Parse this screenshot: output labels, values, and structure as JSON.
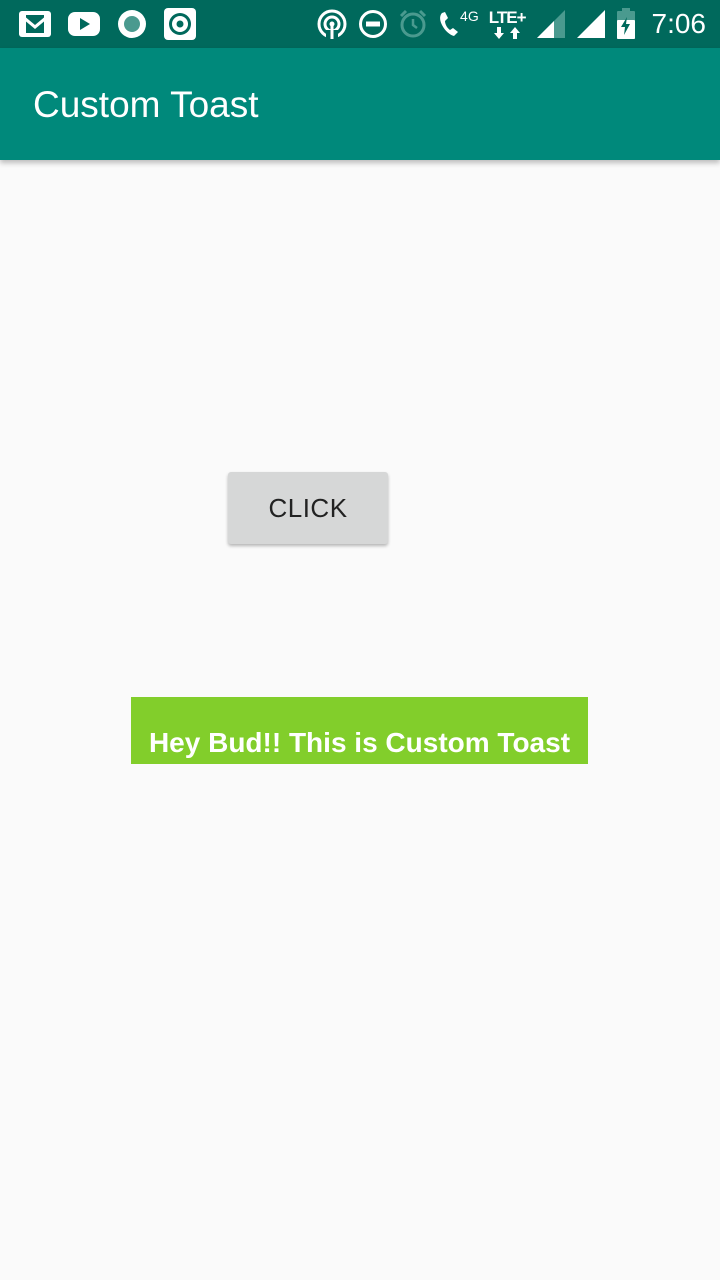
{
  "status_bar": {
    "time": "7:06",
    "network_label": "LTE+",
    "network_sub_label": "4G",
    "left_icons": [
      "gmail-icon",
      "youtube-icon",
      "record-icon",
      "music-app-icon"
    ],
    "right_icons": [
      "hotspot-icon",
      "do-not-disturb-icon",
      "alarm-icon",
      "wifi-calling-icon",
      "signal-icon",
      "signal-icon",
      "battery-charging-icon"
    ],
    "colors": {
      "background": "#00695c",
      "foreground": "#ffffff"
    }
  },
  "app_bar": {
    "title": "Custom Toast",
    "color": "#00897b"
  },
  "main": {
    "button_label": "CLICK",
    "button_color": "#d6d7d7"
  },
  "toast": {
    "message": "Hey Bud!! This is Custom Toast",
    "background_color": "#82ce2b",
    "text_color": "#ffffff"
  }
}
